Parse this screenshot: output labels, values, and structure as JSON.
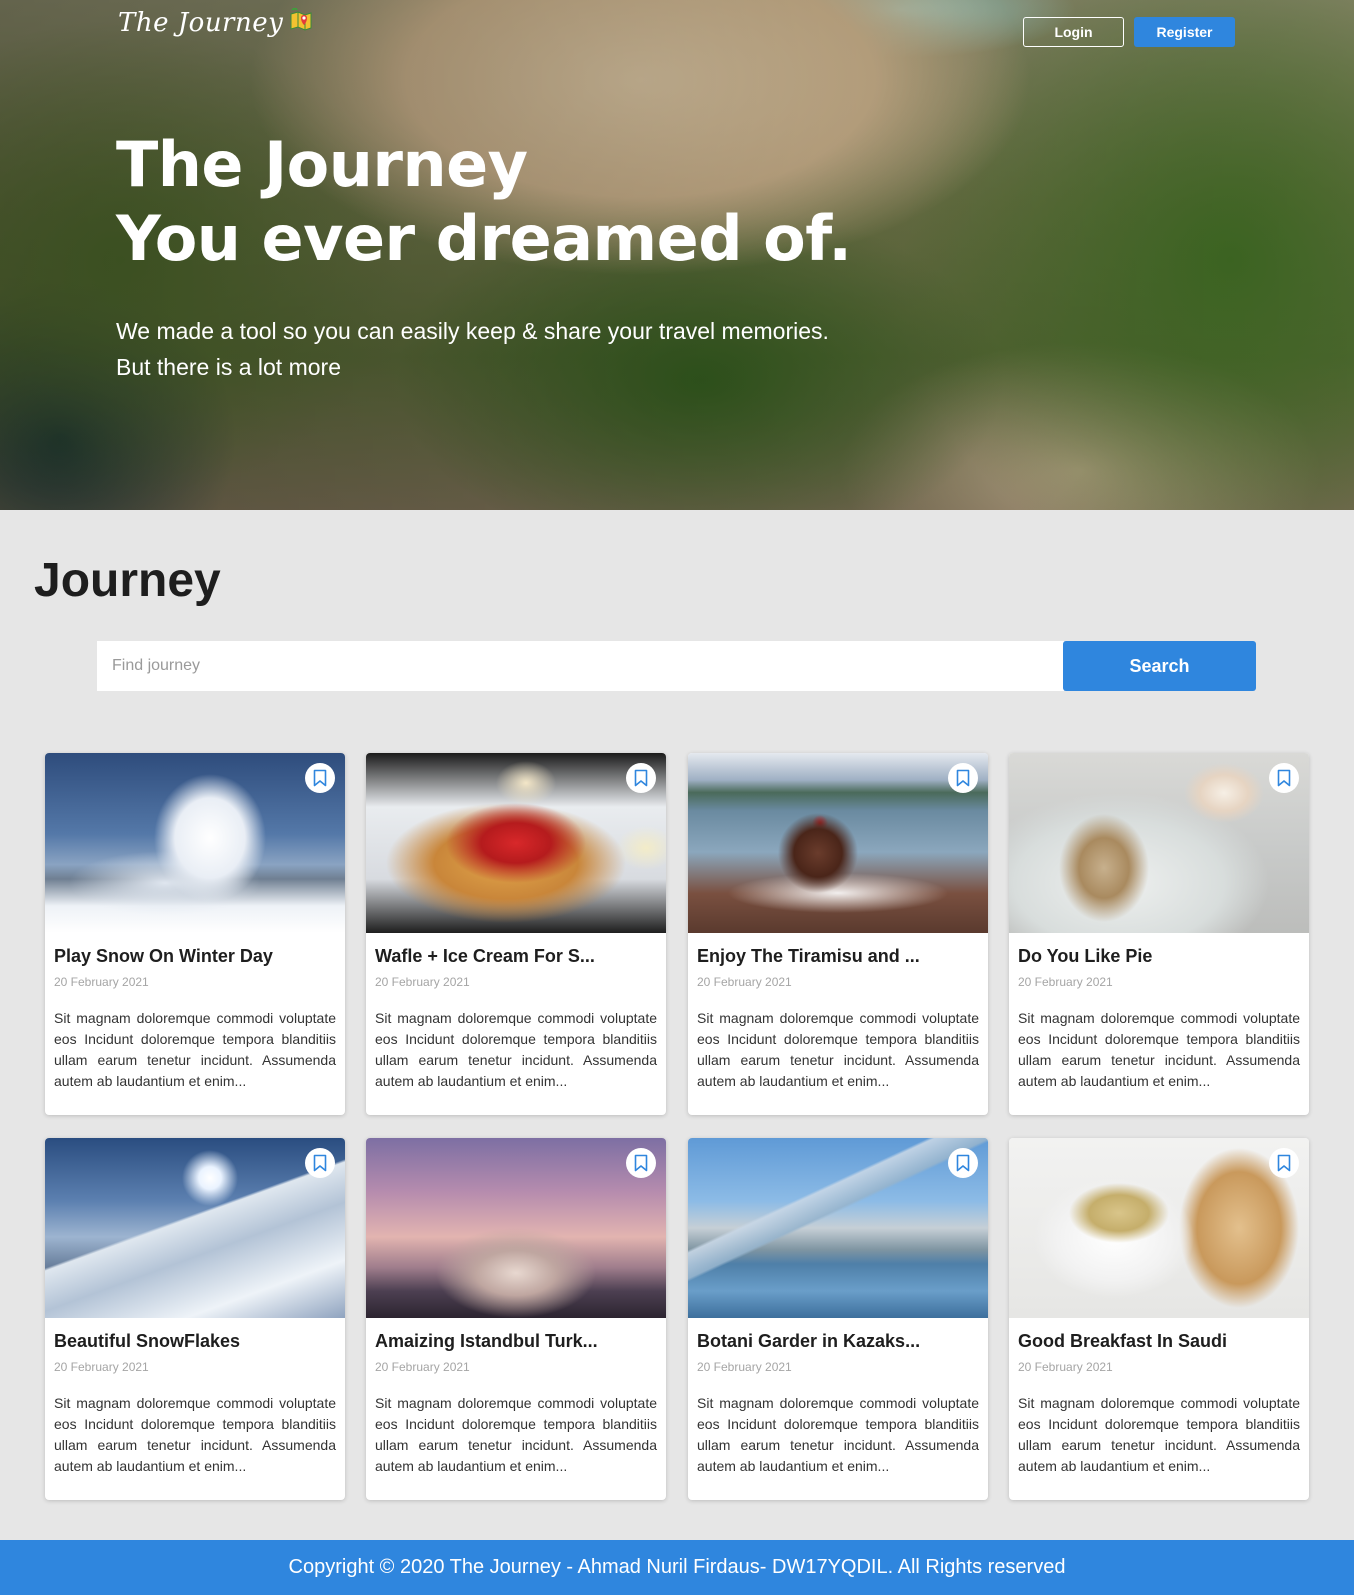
{
  "header": {
    "logo_text": "The Journey",
    "login_label": "Login",
    "register_label": "Register"
  },
  "hero": {
    "title_line1": "The Journey",
    "title_line2": "You ever dreamed of.",
    "subtitle_line1": "We made a tool so you can easily keep & share your travel memories.",
    "subtitle_line2": "But there is a lot more"
  },
  "main": {
    "title": "Journey",
    "search": {
      "placeholder": "Find journey",
      "button_label": "Search"
    },
    "cards": [
      {
        "title": "Play Snow On Winter Day",
        "date": "20 February 2021",
        "desc": "Sit magnam doloremque commodi voluptate eos Incidunt doloremque tempora blanditiis ullam earum tenetur incidunt. Assumenda autem ab laudantium et enim..."
      },
      {
        "title": "Wafle + Ice Cream For S...",
        "date": "20 February 2021",
        "desc": "Sit magnam doloremque commodi voluptate eos Incidunt doloremque tempora blanditiis ullam earum tenetur incidunt. Assumenda autem ab laudantium et enim..."
      },
      {
        "title": "Enjoy The Tiramisu and ...",
        "date": "20 February 2021",
        "desc": "Sit magnam doloremque commodi voluptate eos Incidunt doloremque tempora blanditiis ullam earum tenetur incidunt. Assumenda autem ab laudantium et enim..."
      },
      {
        "title": "Do You Like Pie",
        "date": "20 February 2021",
        "desc": "Sit magnam doloremque commodi voluptate eos Incidunt doloremque tempora blanditiis ullam earum tenetur incidunt. Assumenda autem ab laudantium et enim..."
      },
      {
        "title": "Beautiful SnowFlakes",
        "date": "20 February 2021",
        "desc": "Sit magnam doloremque commodi voluptate eos Incidunt doloremque tempora blanditiis ullam earum tenetur incidunt. Assumenda autem ab laudantium et enim..."
      },
      {
        "title": "Amaizing Istandbul Turk...",
        "date": "20 February 2021",
        "desc": "Sit magnam doloremque commodi voluptate eos Incidunt doloremque tempora blanditiis ullam earum tenetur incidunt. Assumenda autem ab laudantium et enim..."
      },
      {
        "title": "Botani Garder in Kazaks...",
        "date": "20 February 2021",
        "desc": "Sit magnam doloremque commodi voluptate eos Incidunt doloremque tempora blanditiis ullam earum tenetur incidunt. Assumenda autem ab laudantium et enim..."
      },
      {
        "title": "Good Breakfast In Saudi",
        "date": "20 February 2021",
        "desc": "Sit magnam doloremque commodi voluptate eos Incidunt doloremque tempora blanditiis ullam earum tenetur incidunt. Assumenda autem ab laudantium et enim..."
      }
    ]
  },
  "footer": {
    "text": "Copyright © 2020 The Journey - Ahmad Nuril Firdaus- DW17YQDIL. All Rights reserved"
  },
  "colors": {
    "accent": "#2f86de",
    "page_bg": "#e6e6e6"
  },
  "icons": {
    "bookmark": "bookmark-icon",
    "logo": "map-pin-icon"
  }
}
